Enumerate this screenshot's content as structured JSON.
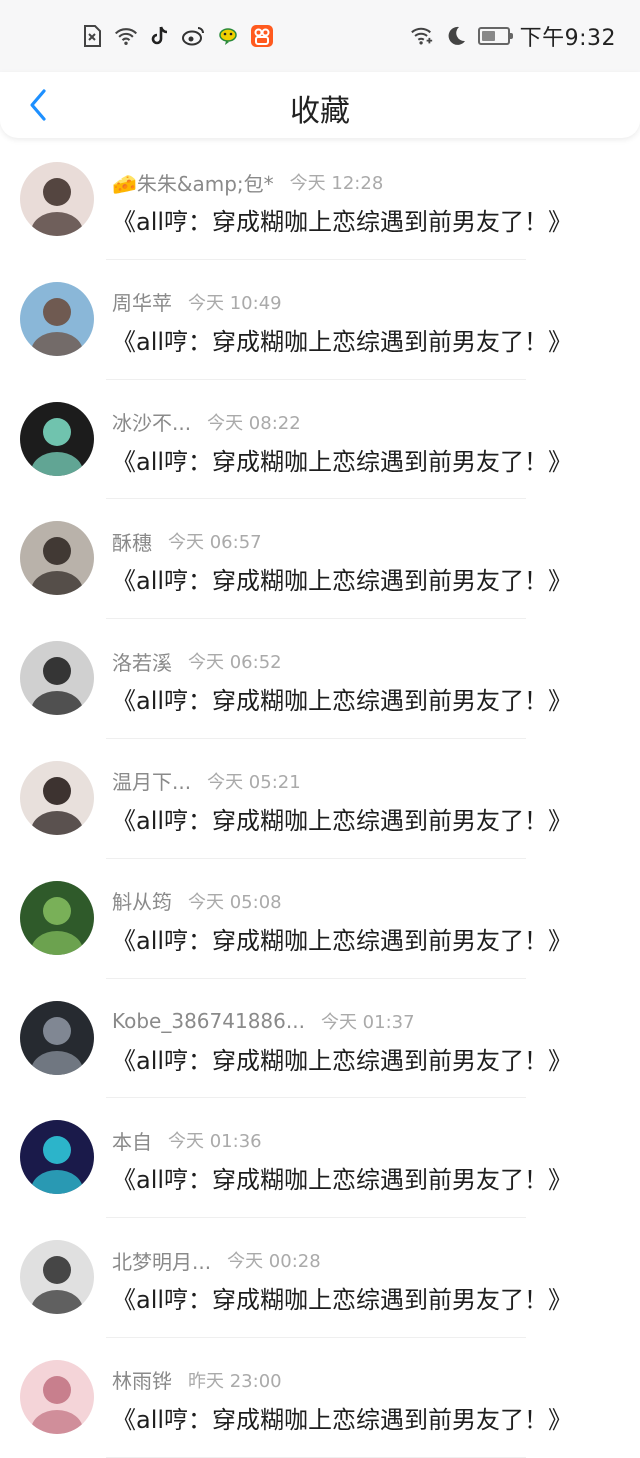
{
  "status_bar": {
    "time": "下午9:32",
    "left_icons": [
      "sim-error-icon",
      "wifi-icon",
      "tiktok-icon",
      "weibo-icon",
      "chat-app-icon",
      "kuaishou-icon"
    ],
    "right_icons": [
      "wifi-plus-icon",
      "moon-icon",
      "battery-icon"
    ],
    "battery_level": 0.55
  },
  "header": {
    "title": "收藏",
    "back_icon": "chevron-left-icon",
    "accent_color": "#1e90ff"
  },
  "favorites": [
    {
      "user": "🧀朱朱&amp;包*",
      "time": "今天 12:28",
      "book": "《all哼：穿成糊咖上恋综遇到前男友了！》",
      "avatar_colors": [
        "#e9dcd8",
        "#3a2a26"
      ]
    },
    {
      "user": "周华苹",
      "time": "今天 10:49",
      "book": "《all哼：穿成糊咖上恋综遇到前男友了！》",
      "avatar_colors": [
        "#8ab7d8",
        "#6a4a3a"
      ]
    },
    {
      "user": "冰沙不...",
      "time": "今天 08:22",
      "book": "《all哼：穿成糊咖上恋综遇到前男友了！》",
      "avatar_colors": [
        "#1c1c1c",
        "#7fe0c8"
      ]
    },
    {
      "user": "酥穗",
      "time": "今天 06:57",
      "book": "《all哼：穿成糊咖上恋综遇到前男友了！》",
      "avatar_colors": [
        "#b9b2aa",
        "#2b2320"
      ]
    },
    {
      "user": "洛若溪",
      "time": "今天 06:52",
      "book": "《all哼：穿成糊咖上恋综遇到前男友了！》",
      "avatar_colors": [
        "#d0d0d0",
        "#1a1a1a"
      ]
    },
    {
      "user": "温月下...",
      "time": "今天 05:21",
      "book": "《all哼：穿成糊咖上恋综遇到前男友了！》",
      "avatar_colors": [
        "#e8e0dc",
        "#1e1412"
      ]
    },
    {
      "user": "斛从筠",
      "time": "今天 05:08",
      "book": "《all哼：穿成糊咖上恋综遇到前男友了！》",
      "avatar_colors": [
        "#2f5a2a",
        "#86c060"
      ]
    },
    {
      "user": "Kobe_386741886...",
      "time": "今天 01:37",
      "book": "《all哼：穿成糊咖上恋综遇到前男友了！》",
      "avatar_colors": [
        "#262a30",
        "#9098a4"
      ]
    },
    {
      "user": "本自",
      "time": "今天 01:36",
      "book": "《all哼：穿成糊咖上恋综遇到前男友了！》",
      "avatar_colors": [
        "#1a1a4a",
        "#30d0e0"
      ]
    },
    {
      "user": "北梦明月...",
      "time": "今天 00:28",
      "book": "《all哼：穿成糊咖上恋综遇到前男友了！》",
      "avatar_colors": [
        "#e0e0e0",
        "#2a2a2a"
      ]
    },
    {
      "user": "林雨铧",
      "time": "昨天 23:00",
      "book": "《all哼：穿成糊咖上恋综遇到前男友了！》",
      "avatar_colors": [
        "#f4d4d8",
        "#c07080"
      ]
    }
  ]
}
